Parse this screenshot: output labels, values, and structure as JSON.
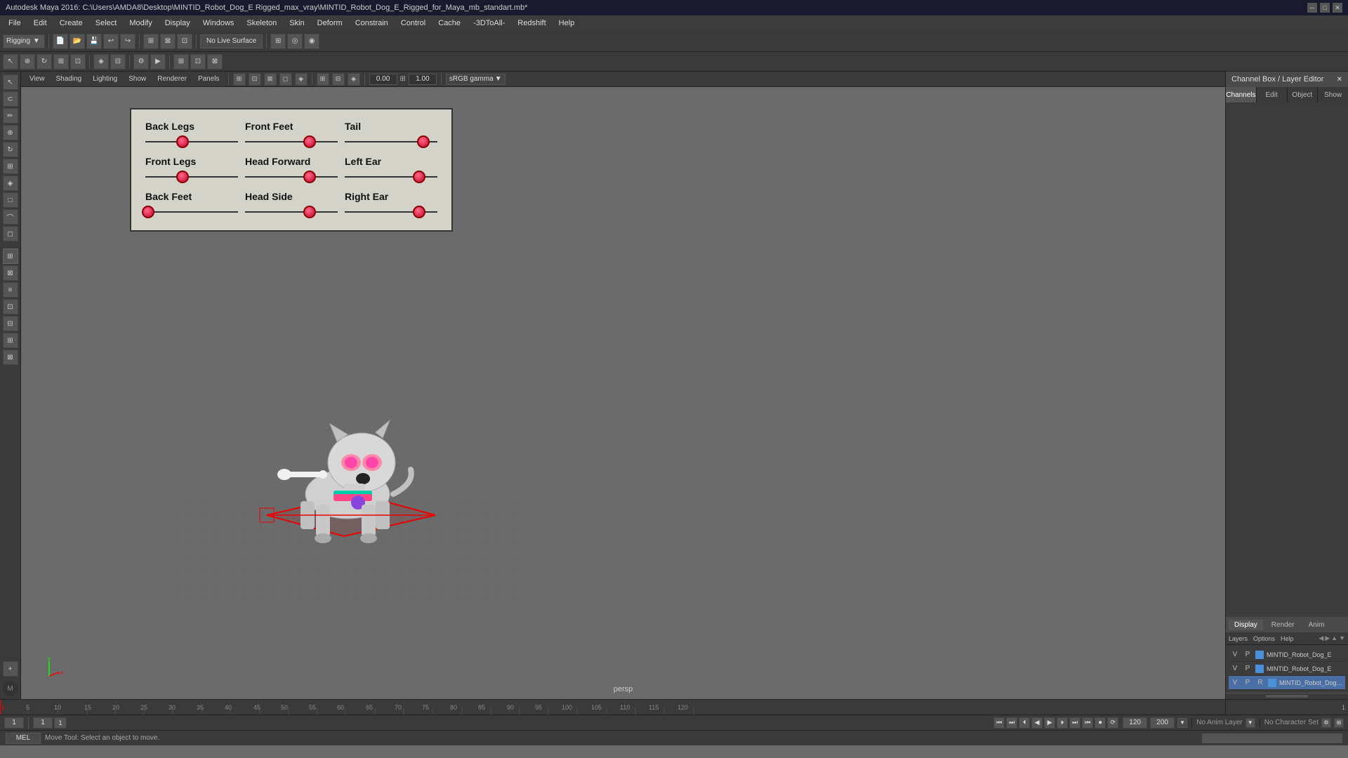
{
  "window": {
    "title": "Autodesk Maya 2016: C:\\Users\\AMDA8\\Desktop\\MINTID_Robot_Dog_E Rigged_max_vray\\MINTID_Robot_Dog_E_Rigged_for_Maya_mb_standart.mb*"
  },
  "menu": {
    "items": [
      "File",
      "Edit",
      "Create",
      "Select",
      "Modify",
      "Display",
      "Windows",
      "Skeleton",
      "Skin",
      "Deform",
      "Constrain",
      "Control",
      "Cache",
      "-3DToAll-",
      "Redshift",
      "Help"
    ]
  },
  "toolbar": {
    "mode": "Rigging",
    "live_surface": "No Live Surface"
  },
  "viewport": {
    "menus": [
      "View",
      "Shading",
      "Lighting",
      "Show",
      "Renderer",
      "Panels"
    ],
    "value1": "0.00",
    "value2": "1.00",
    "gamma": "sRGB gamma",
    "label": "persp"
  },
  "control_panel": {
    "sliders": [
      {
        "label": "Back Legs",
        "value": 0.4
      },
      {
        "label": "Front Feet",
        "value": 0.7
      },
      {
        "label": "Tail",
        "value": 0.85
      },
      {
        "label": "Front Legs",
        "value": 0.4
      },
      {
        "label": "Head Forward",
        "value": 0.7
      },
      {
        "label": "Left Ear",
        "value": 0.8
      },
      {
        "label": "Back Feet",
        "value": 0.03
      },
      {
        "label": "Head Side",
        "value": 0.7
      },
      {
        "label": "Right Ear",
        "value": 0.8
      }
    ]
  },
  "channel_box": {
    "header": "Channel Box / Layer Editor",
    "tabs": [
      "Channels",
      "Edit",
      "Object",
      "Show"
    ]
  },
  "layer_panel": {
    "tabs": [
      "Display",
      "Render",
      "Anim"
    ],
    "active_tab": "Display",
    "sub_tabs": [
      "Layers",
      "Options",
      "Help"
    ],
    "layers": [
      {
        "v": "V",
        "p": "P",
        "r": "",
        "color": "#4a90d9",
        "name": "MINTID_Robot_Dog_E"
      },
      {
        "v": "V",
        "p": "P",
        "r": "",
        "color": "#4a90d9",
        "name": "MINTID_Robot_Dog_E"
      },
      {
        "v": "V",
        "p": "P",
        "r": "R",
        "color": "#4a90d9",
        "name": "MINTID_Robot_Dog_E",
        "selected": true
      }
    ]
  },
  "timeline": {
    "ticks": [
      5,
      10,
      15,
      20,
      25,
      30,
      35,
      40,
      45,
      50,
      55,
      60,
      65,
      70,
      75,
      80,
      85,
      90,
      95,
      100,
      105,
      110,
      115,
      120
    ],
    "start": 1,
    "end": 120,
    "current": 1
  },
  "bottom_bar": {
    "frame_current": "1",
    "frame_start": "1",
    "frame_marker": "1",
    "frame_end": "120",
    "frame_total": "200",
    "anim_layer": "No Anim Layer",
    "char_set": "No Character Set",
    "mel_label": "MEL"
  },
  "status_bar": {
    "text": "Move Tool: Select an object to move."
  },
  "transport_buttons": [
    "⏮",
    "⏭",
    "⏴",
    "◀",
    "▶",
    "⏵",
    "⏭",
    "⏺",
    "⟳"
  ],
  "lighting_menu": "Lighting"
}
